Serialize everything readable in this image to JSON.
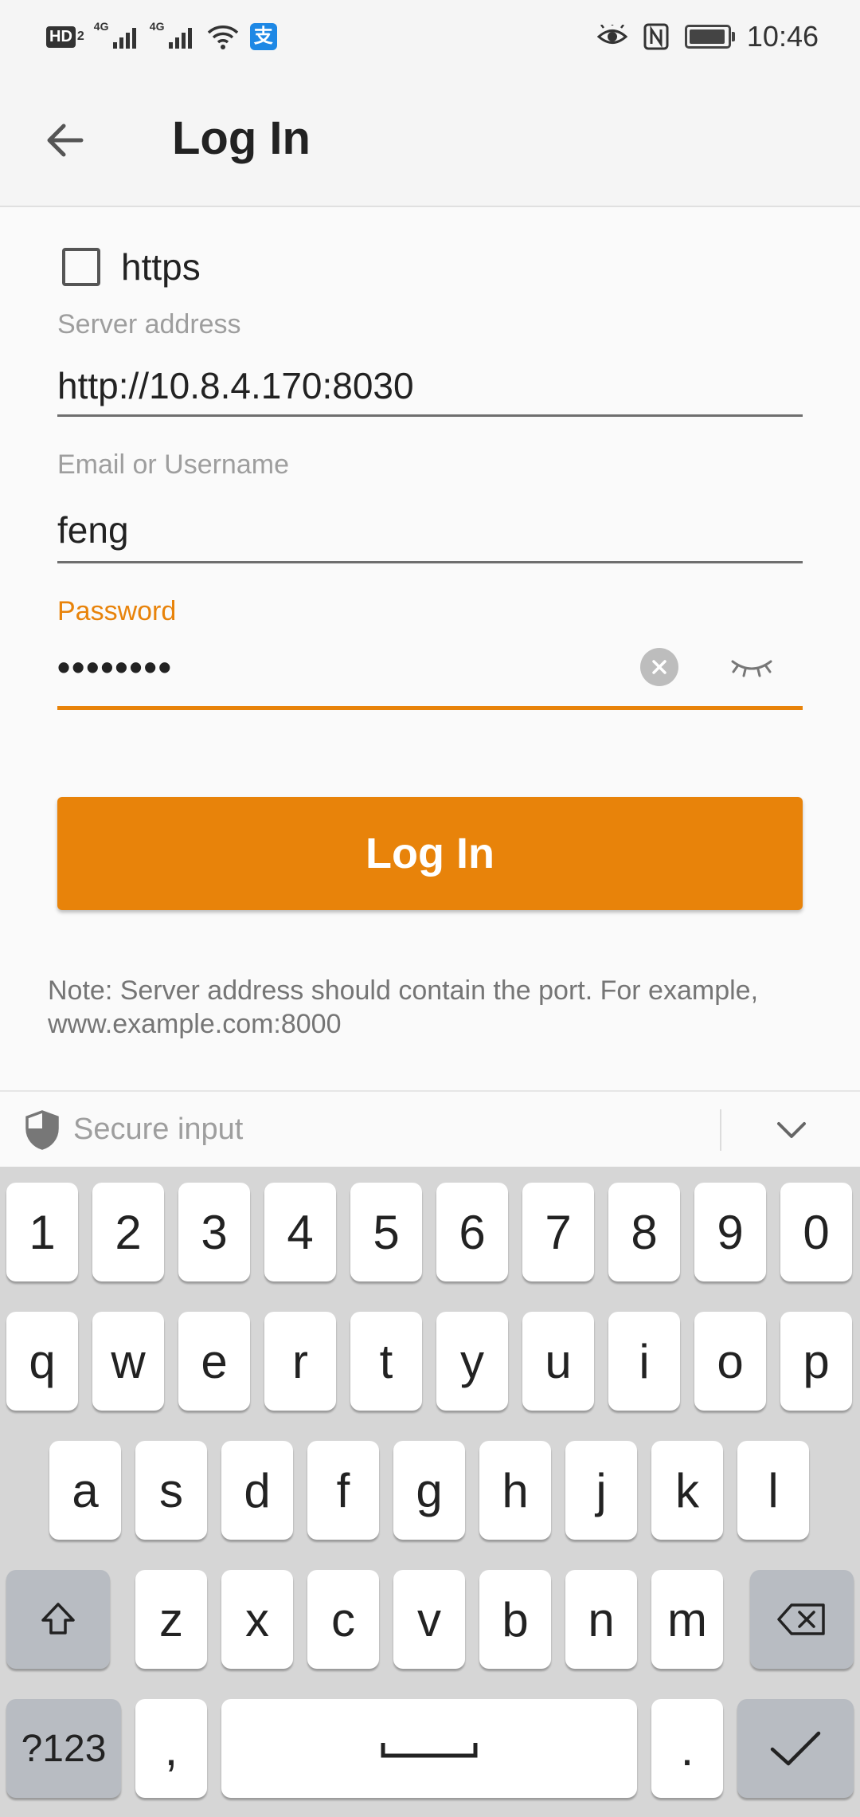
{
  "status_bar": {
    "hd_label": "HD",
    "hd_sub": "2",
    "signal1_label": "4G",
    "signal2_label": "4G",
    "alipay_glyph": "支",
    "time": "10:46",
    "battery_level": 0.95,
    "icons": [
      "hd-icon",
      "signal-icon",
      "signal-icon",
      "wifi-icon",
      "alipay-icon",
      "eye-icon",
      "nfc-icon",
      "battery-icon"
    ]
  },
  "app_bar": {
    "title": "Log In",
    "back_icon": "arrow-back-icon"
  },
  "form": {
    "https_label": "https",
    "https_checked": false,
    "server_label": "Server address",
    "server_value": "http://10.8.4.170:8030",
    "username_label": "Email or Username",
    "username_value": "feng",
    "password_label": "Password",
    "password_value": "••••••••",
    "login_button": "Log In",
    "note": "Note: Server address should contain the port. For example, www.example.com:8000"
  },
  "secure_bar": {
    "label": "Secure input",
    "icon": "shield-icon",
    "collapse_icon": "chevron-down-icon"
  },
  "keyboard": {
    "row_numbers": [
      "1",
      "2",
      "3",
      "4",
      "5",
      "6",
      "7",
      "8",
      "9",
      "0"
    ],
    "row_q": [
      "q",
      "w",
      "e",
      "r",
      "t",
      "y",
      "u",
      "i",
      "o",
      "p"
    ],
    "row_a": [
      "a",
      "s",
      "d",
      "f",
      "g",
      "h",
      "j",
      "k",
      "l"
    ],
    "row_z": [
      "z",
      "x",
      "c",
      "v",
      "b",
      "n",
      "m"
    ],
    "symbols_key": "?123",
    "comma_key": ",",
    "period_key": "."
  },
  "colors": {
    "accent": "#e8830a",
    "label_gray": "#9e9e9e",
    "keyboard_bg": "#d6d6d6"
  }
}
